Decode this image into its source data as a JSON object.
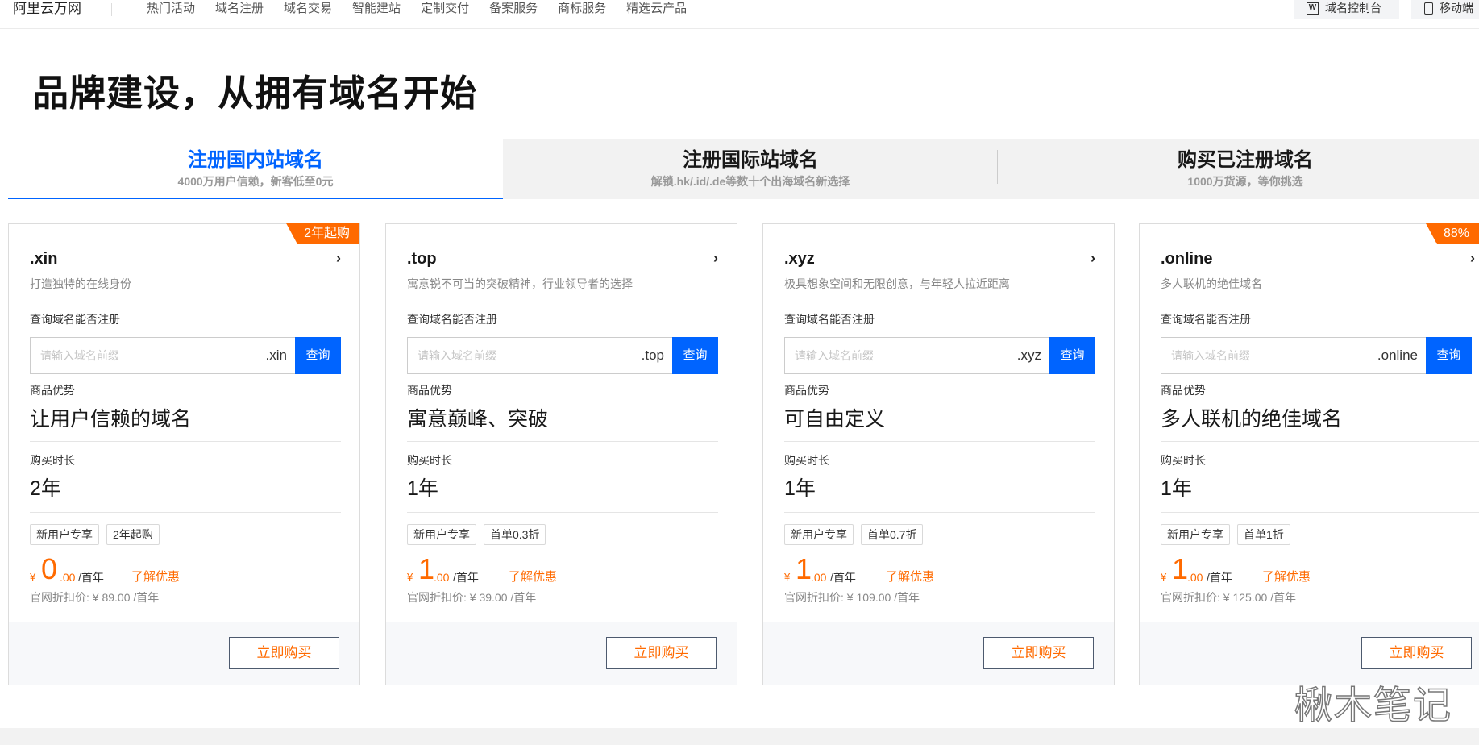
{
  "nav": {
    "brand": "阿里云万网",
    "items": [
      "热门活动",
      "域名注册",
      "域名交易",
      "智能建站",
      "定制交付",
      "备案服务",
      "商标服务",
      "精选云产品"
    ],
    "console_label": "域名控制台",
    "mobile_label": "移动端"
  },
  "headline": "品牌建设，从拥有域名开始",
  "tabs": [
    {
      "title": "注册国内站域名",
      "subtitle": "4000万用户信赖，新客低至0元"
    },
    {
      "title": "注册国际站域名",
      "subtitle": "解锁.hk/.id/.de等数十个出海域名新选择"
    },
    {
      "title": "购买已注册域名",
      "subtitle": "1000万货源，等你挑选"
    }
  ],
  "common": {
    "query_label": "查询域名能否注册",
    "placeholder": "请输入域名前缀",
    "query_button": "查询",
    "advantage_label": "商品优势",
    "duration_label": "购买时长",
    "currency": "¥",
    "per_year": "/首年",
    "promo_link": "了解优惠",
    "buy_button": "立即购买",
    "chevron": "›"
  },
  "cards": [
    {
      "tld": ".xin",
      "badge": "2年起购",
      "desc": "打造独特的在线身份",
      "advantage": "让用户信赖的域名",
      "duration": "2年",
      "tags": [
        "新用户专享",
        "2年起购"
      ],
      "price_int": "0",
      "price_dec": ".00",
      "ref_price": "官网折扣价: ¥ 89.00 /首年"
    },
    {
      "tld": ".top",
      "badge": "",
      "desc": "寓意锐不可当的突破精神，行业领导者的选择",
      "advantage": "寓意巅峰、突破",
      "duration": "1年",
      "tags": [
        "新用户专享",
        "首单0.3折"
      ],
      "price_int": "1",
      "price_dec": ".00",
      "ref_price": "官网折扣价: ¥ 39.00 /首年"
    },
    {
      "tld": ".xyz",
      "badge": "",
      "desc": "极具想象空间和无限创意，与年轻人拉近距离",
      "advantage": "可自由定义",
      "duration": "1年",
      "tags": [
        "新用户专享",
        "首单0.7折"
      ],
      "price_int": "1",
      "price_dec": ".00",
      "ref_price": "官网折扣价: ¥ 109.00 /首年"
    },
    {
      "tld": ".online",
      "badge": "88%",
      "desc": "多人联机的绝佳域名",
      "advantage": "多人联机的绝佳域名",
      "duration": "1年",
      "tags": [
        "新用户专享",
        "首单1折"
      ],
      "price_int": "1",
      "price_dec": ".00",
      "ref_price": "官网折扣价: ¥ 125.00 /首年"
    }
  ],
  "watermark": "楸木笔记",
  "colors": {
    "accent": "#0064ff",
    "orange": "#ff6a00"
  }
}
